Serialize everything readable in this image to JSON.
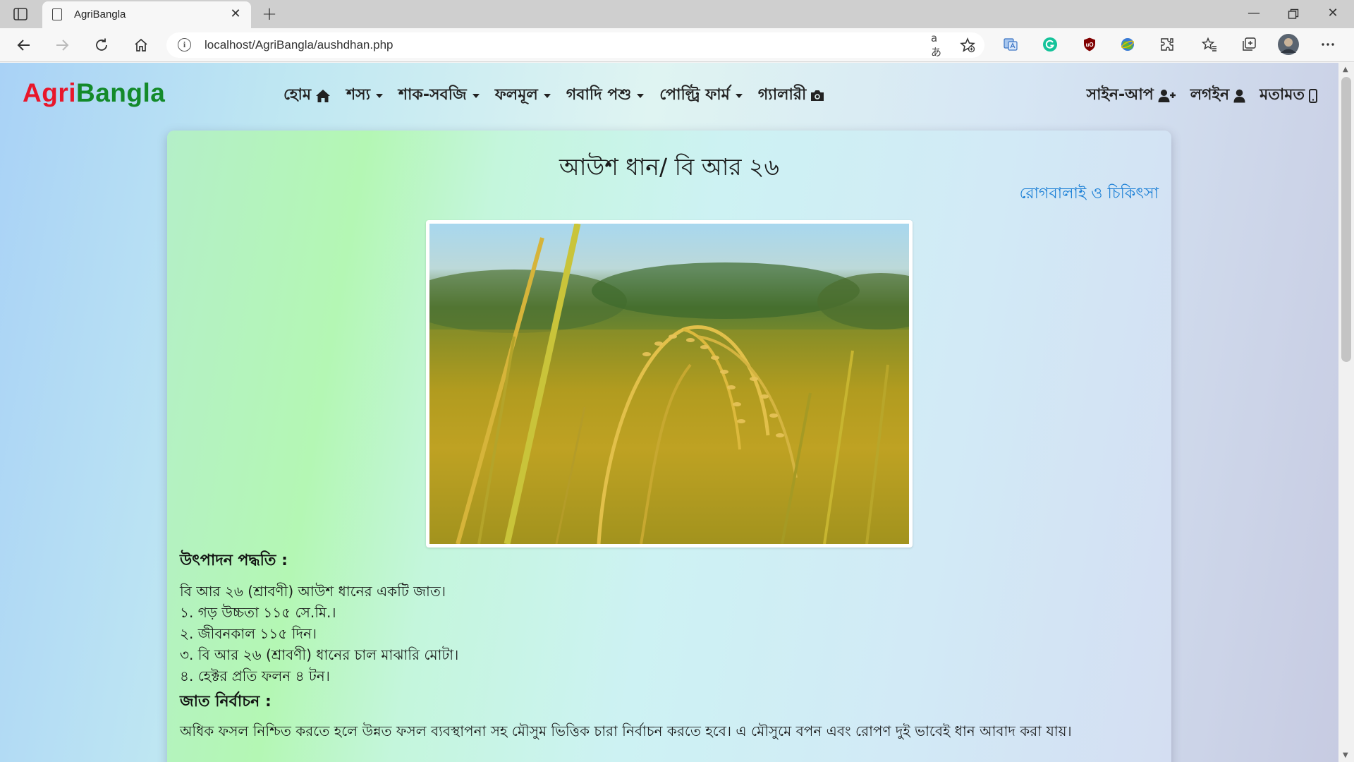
{
  "browser": {
    "tab_title": "AgriBangla",
    "url": "localhost/AgriBangla/aushdhan.php",
    "read_aloud_label": "aあ"
  },
  "site": {
    "brand_part1": "Agri",
    "brand_part2": "Bangla",
    "menu": [
      {
        "label": "হোম"
      },
      {
        "label": "শস্য"
      },
      {
        "label": "শাক-সবজি"
      },
      {
        "label": "ফলমূল"
      },
      {
        "label": "গবাদি পশু"
      },
      {
        "label": "পোল্ট্রি ফার্ম"
      },
      {
        "label": "গ্যালারী"
      }
    ],
    "right_menu": [
      {
        "label": "সাইন-আপ"
      },
      {
        "label": "লগইন"
      },
      {
        "label": "মতামত"
      }
    ]
  },
  "content": {
    "title": "আউশ ধান/ বি আর ২৬",
    "disease_link": "রোগবালাই ও চিকিৎসা",
    "section1_heading": "উৎপাদন পদ্ধতি :",
    "section1_lines": [
      "বি আর ২৬ (শ্রাবণী) আউশ ধানের একটি জাত।",
      "১. গড় উচ্চতা ১১৫ সে.মি.।",
      "২. জীবনকাল ১১৫ দিন।",
      "৩. বি আর ২৬ (শ্রাবণী) ধানের চাল মাঝারি মোটা।",
      "৪. হেক্টর প্রতি ফলন ৪ টন।"
    ],
    "section2_heading": "জাত নির্বাচন :",
    "section2_text": "অধিক ফসল নিশ্চিত করতে হলে উন্নত ফসল ব্যবস্থাপনা সহ মৌসুম ভিত্তিক চারা নির্বাচন করতে হবে। এ মৌসুমে বপন এবং রোপণ দুই ভাবেই ধান আবাদ করা যায়।"
  },
  "colors": {
    "brand_red": "#e8162a",
    "brand_green": "#138a2a",
    "link_blue": "#1a7fd6"
  }
}
